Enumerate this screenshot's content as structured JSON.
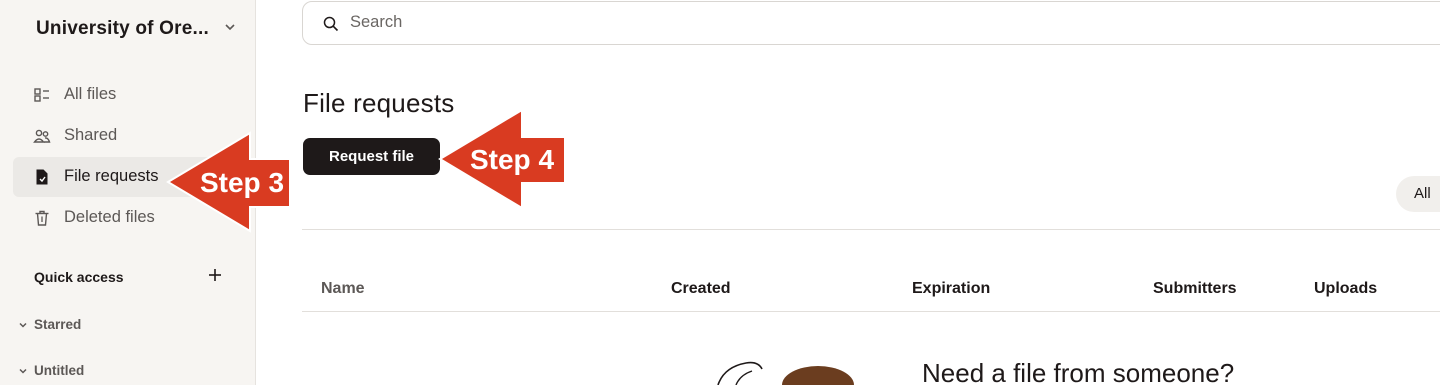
{
  "sidebar": {
    "org_name": "University of Ore...",
    "nav": [
      {
        "label": "All files",
        "icon": "folders-icon"
      },
      {
        "label": "Shared",
        "icon": "shared-people-icon"
      },
      {
        "label": "File requests",
        "icon": "file-request-icon"
      },
      {
        "label": "Deleted files",
        "icon": "trash-icon"
      }
    ],
    "active_item": "File requests",
    "quick_access_label": "Quick access",
    "groups": [
      {
        "label": "Starred"
      },
      {
        "label": "Untitled"
      }
    ]
  },
  "search": {
    "placeholder": "Search"
  },
  "main": {
    "title": "File requests",
    "request_button": "Request file",
    "filter_pill": "All",
    "table_headers": [
      "Name",
      "Created",
      "Expiration",
      "Submitters",
      "Uploads"
    ],
    "empty_state_title": "Need a file from someone?"
  },
  "annotations": {
    "step3": "Step 3",
    "step4": "Step 4",
    "arrow_color": "#d93b21"
  },
  "colors": {
    "sidebar_bg": "#f7f5f2",
    "primary_button": "#1e1919"
  }
}
